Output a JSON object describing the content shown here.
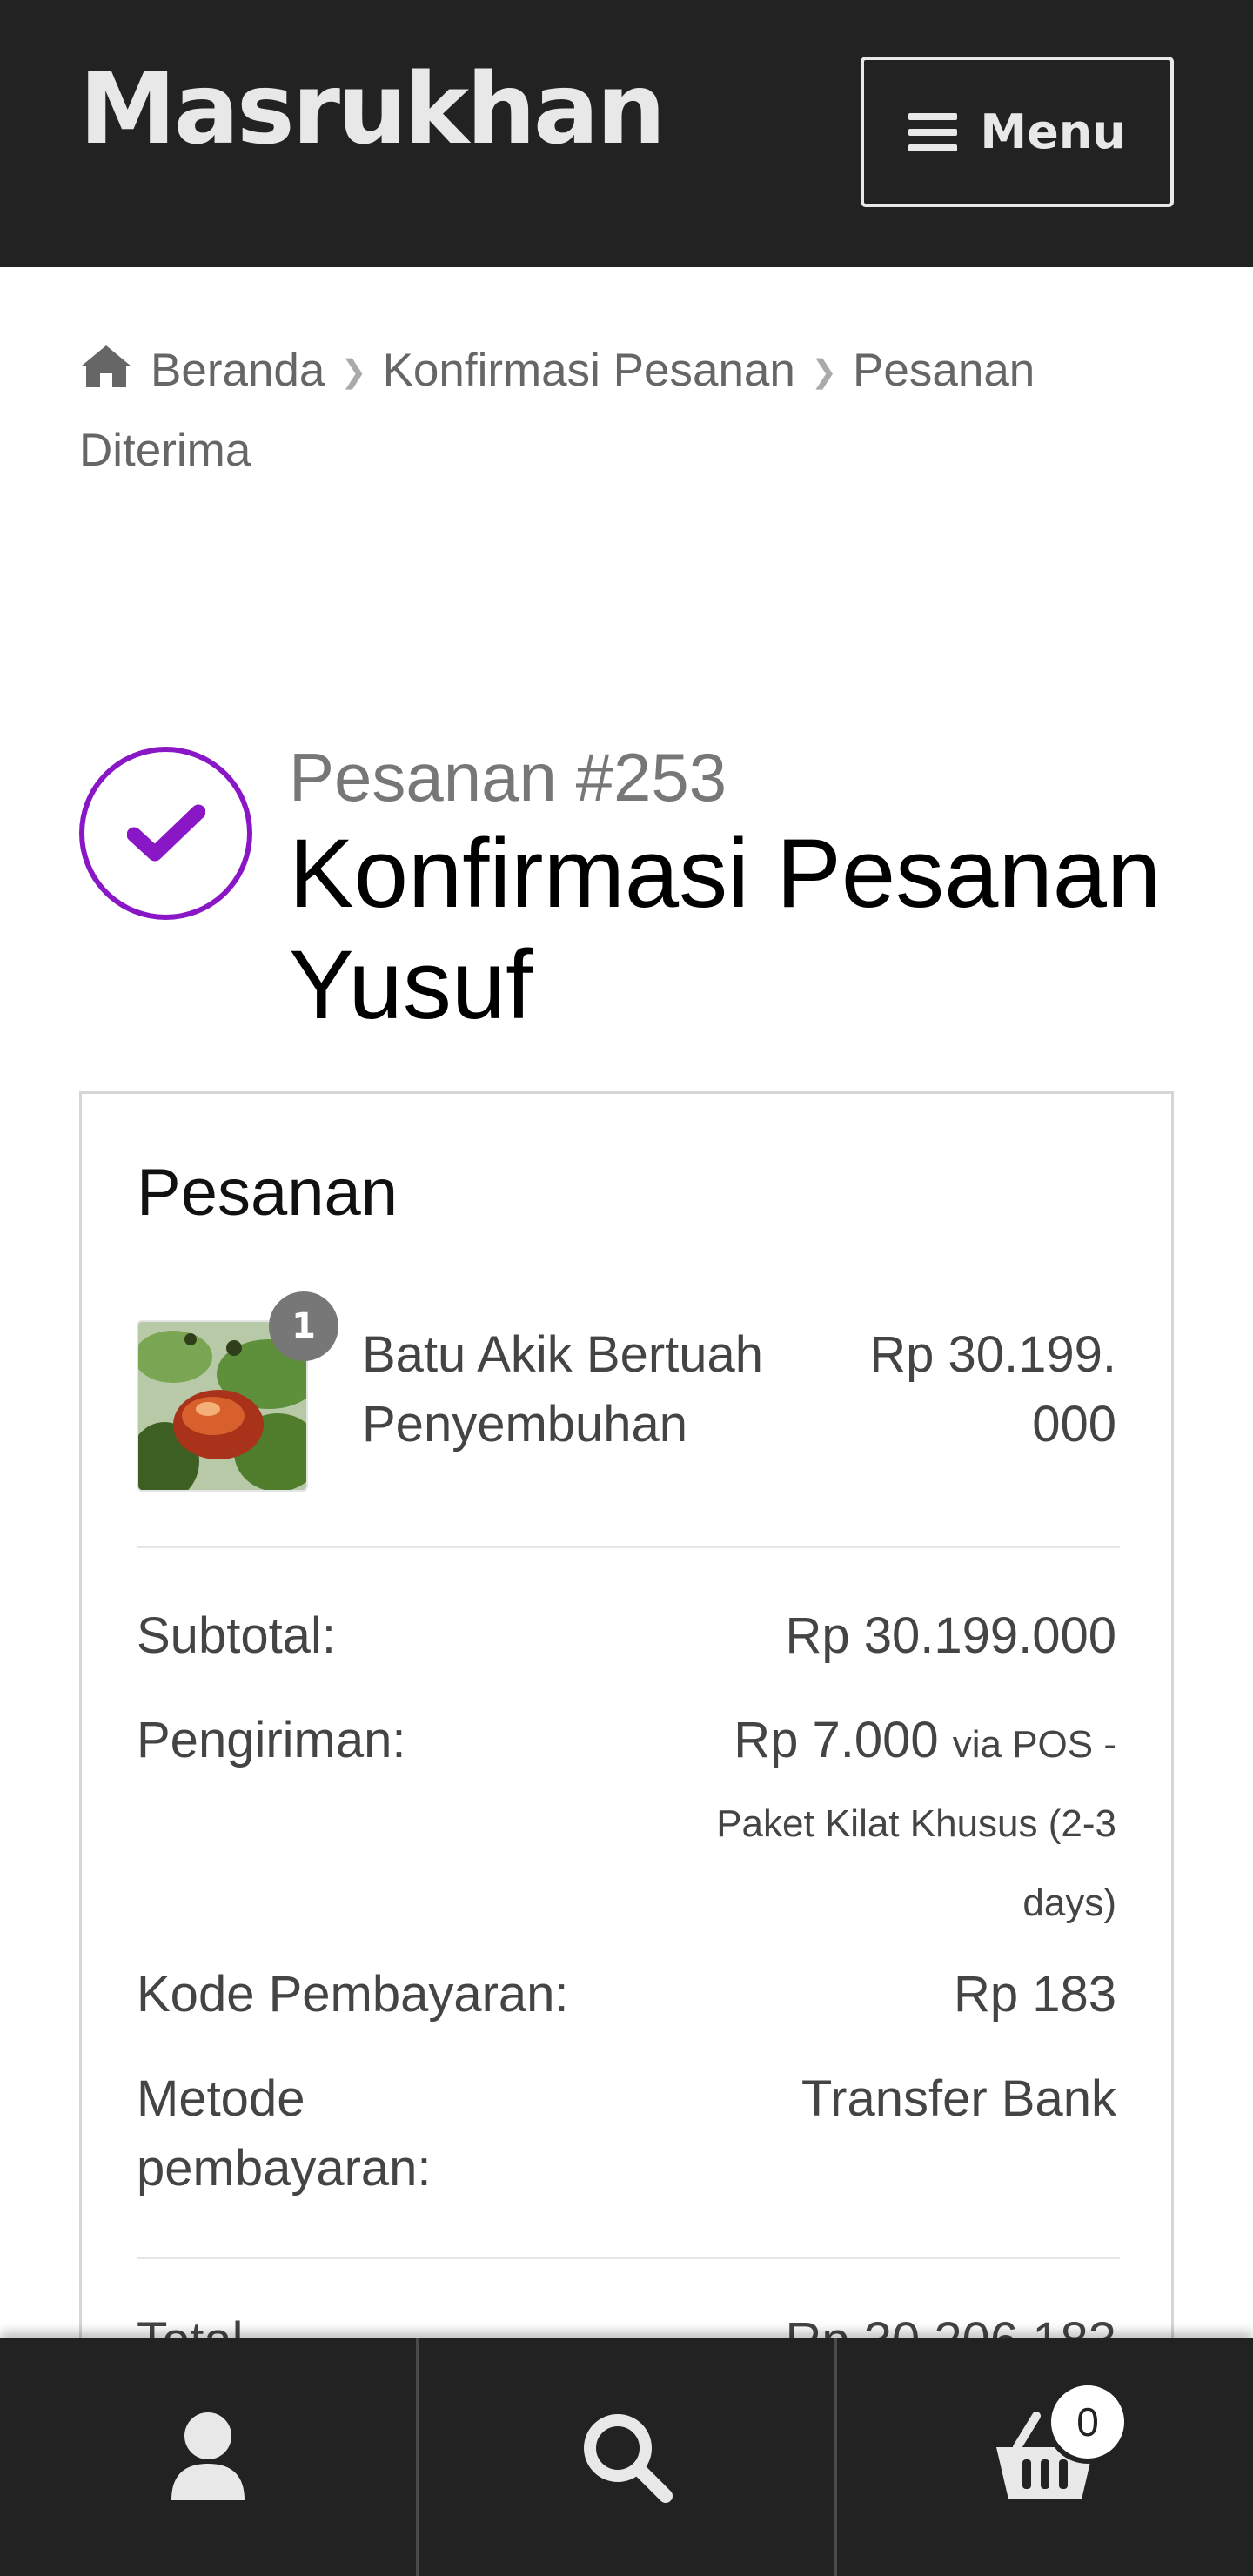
{
  "header": {
    "site_title": "Masrukhan",
    "menu_label": "Menu"
  },
  "breadcrumb": {
    "items": [
      "Beranda",
      "Konfirmasi Pesanan",
      "Pesanan Diterima"
    ]
  },
  "order": {
    "number": "Pesanan #253",
    "title": "Konfirmasi Pesanan Yusuf",
    "accent_color": "#8a17c6"
  },
  "summary": {
    "heading": "Pesanan",
    "product": {
      "quantity": "1",
      "name": "Batu Akik Bertuah Penyembuhan",
      "price": "Rp 30.199.000"
    },
    "rows": {
      "subtotal_label": "Subtotal:",
      "subtotal_value": "Rp 30.199.000",
      "shipping_label": "Pengiriman:",
      "shipping_value": "Rp 7.000",
      "shipping_method": "via POS - Paket Kilat Khusus (2-3 days)",
      "payment_code_label": "Kode Pembayaran:",
      "payment_code_value": "Rp 183",
      "payment_method_label": "Metode pembayaran:",
      "payment_method_value": "Transfer Bank",
      "total_label": "Total",
      "total_value": "Rp 30.206.183"
    }
  },
  "bottom_bar": {
    "icons": [
      "account-icon",
      "search-icon",
      "cart-icon"
    ],
    "cart_count": "0"
  }
}
